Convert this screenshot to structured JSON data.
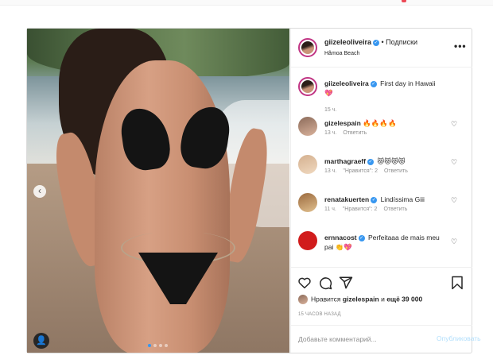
{
  "header": {
    "username": "giizeleoliveira",
    "verified_icon": "verified-badge-icon",
    "follow_label": " • Подписки",
    "location": "Hâmoa Beach",
    "more_icon": "more-options-icon",
    "more_glyph": "•••"
  },
  "caption": {
    "username": "giizeleoliveira",
    "text": "First day in Hawaii",
    "emoji": "💖",
    "time": "15 ч."
  },
  "comments": [
    {
      "username": "gizelespain",
      "verified": false,
      "text": "🔥🔥🔥🔥",
      "time": "13 ч.",
      "likes": "",
      "reply": "Ответить"
    },
    {
      "username": "marthagraeff",
      "verified": true,
      "text": "😻😻😻😻",
      "time": "13 ч.",
      "likes": "\"Нравится\": 2",
      "reply": "Ответить"
    },
    {
      "username": "renatakuerten",
      "verified": true,
      "text": "Lindíssima Giii",
      "time": "11 ч.",
      "likes": "\"Нравится\": 2",
      "reply": "Ответить"
    },
    {
      "username": "ernnacost",
      "verified": true,
      "text": "Perfeitaaa de mais meu pai 👏💖",
      "time": "",
      "likes": "",
      "reply": ""
    }
  ],
  "actions": {
    "like_icon": "heart-icon",
    "comment_icon": "comment-icon",
    "share_icon": "send-icon",
    "save_icon": "bookmark-icon"
  },
  "likes": {
    "prefix": "Нравится ",
    "user": "gizelespain",
    "suffix": " и ",
    "count": "ещё 39 000"
  },
  "posted_ago": "15 ЧАСОВ НАЗАД",
  "comment_input": {
    "placeholder": "Добавьте комментарий...",
    "post_label": "Опубликовать"
  },
  "carousel": {
    "prev_glyph": "‹",
    "user_tag_glyph": "👤"
  },
  "colors": {
    "link_blue": "#3897f0",
    "muted": "#8e8e8e",
    "border": "#dbdbdb",
    "post_disabled": "#b2dffc"
  }
}
